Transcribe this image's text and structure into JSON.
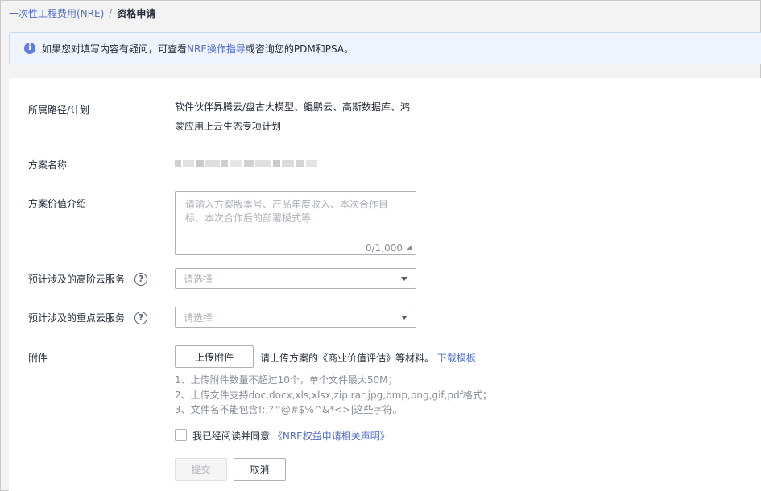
{
  "breadcrumb": {
    "parent": "一次性工程费用(NRE)",
    "separator": "/",
    "current": "资格申请"
  },
  "banner": {
    "text_before": "如果您对填写内容有疑问，可查看",
    "link": "NRE操作指导",
    "text_after": "或咨询您的PDM和PSA。"
  },
  "form": {
    "route": {
      "label": "所属路径/计划",
      "value_line1": "软件伙伴昇腾云/盘古大模型、鲲鹏云、高斯数据库、鸿",
      "value_line2": "蒙应用上云生态专项计划"
    },
    "plan_name": {
      "label": "方案名称"
    },
    "value_intro": {
      "label": "方案价值介绍",
      "placeholder": "请输入方案版本号、产品年度收入、本次合作目标、本次合作后的部署模式等",
      "counter": "0/1,000"
    },
    "advanced_services": {
      "label": "预计涉及的高阶云服务",
      "placeholder": "请选择"
    },
    "key_services": {
      "label": "预计涉及的重点云服务",
      "placeholder": "请选择"
    },
    "attachment": {
      "label": "附件",
      "upload_button": "上传附件",
      "hint": "请上传方案的《商业价值评估》等材料。",
      "download_link": "下载模板",
      "rule1": "1、上传附件数量不超过10个，单个文件最大50M；",
      "rule2": "2、上传文件支持doc,docx,xls,xlsx,zip,rar,jpg,bmp,png,gif,pdf格式；",
      "rule3": "3、文件名不能包含!:;?\"'@#$%^&*<>|这些字符。"
    },
    "agreement": {
      "text": "我已经阅读并同意",
      "link": "《NRE权益申请相关声明》"
    },
    "submit_label": "提交",
    "cancel_label": "取消"
  },
  "colors": {
    "link": "#526ecc",
    "banner_bg": "#eef3fe",
    "info_icon": "#5e7ce0"
  }
}
